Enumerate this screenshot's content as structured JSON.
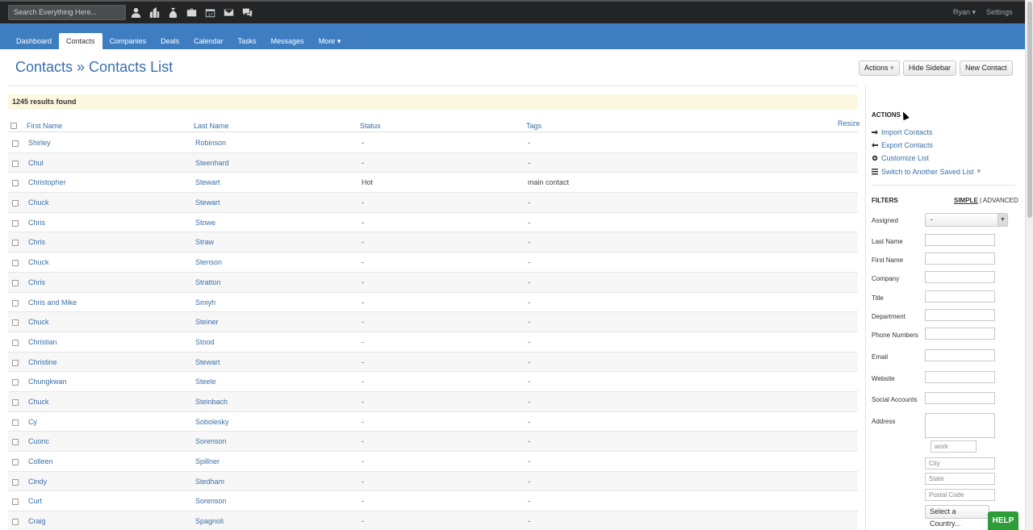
{
  "topbar": {
    "search_placeholder": "Search Everything Here...",
    "icons": [
      "person-icon",
      "building-icon",
      "money-bag-icon",
      "briefcase-icon",
      "calendar-icon",
      "envelope-icon",
      "chat-icon"
    ],
    "calendar_day": "17",
    "user_label": "Ryan",
    "settings_label": "Settings"
  },
  "nav": {
    "tabs": [
      "Dashboard",
      "Contacts",
      "Companies",
      "Deals",
      "Calendar",
      "Tasks",
      "Messages",
      "More"
    ],
    "active_tab": "Contacts"
  },
  "header": {
    "title": "Contacts » Contacts List",
    "actions_label": "Actions",
    "hide_sidebar_label": "Hide Sidebar",
    "new_contact_label": "New Contact"
  },
  "results": {
    "text": "1245 results found"
  },
  "table": {
    "columns": [
      "First Name",
      "Last Name",
      "Status",
      "Tags"
    ],
    "resize_label": "Resize",
    "rows": [
      [
        "Shirley",
        "Robinson",
        "-",
        "-"
      ],
      [
        "Chul",
        "Steenhard",
        "-",
        "-"
      ],
      [
        "Christopher",
        "Stewart",
        "Hot",
        "main contact"
      ],
      [
        "Chuck",
        "Stewart",
        "-",
        "-"
      ],
      [
        "Chris",
        "Stowe",
        "-",
        "-"
      ],
      [
        "Chris",
        "Straw",
        "-",
        "-"
      ],
      [
        "Chuck",
        "Stenson",
        "-",
        "-"
      ],
      [
        "Chris",
        "Stratton",
        "-",
        "-"
      ],
      [
        "Chris and Mike",
        "Smiyh",
        "-",
        "-"
      ],
      [
        "Chuck",
        "Steiner",
        "-",
        "-"
      ],
      [
        "Christian",
        "Stood",
        "-",
        "-"
      ],
      [
        "Christine",
        "Stewart",
        "-",
        "-"
      ],
      [
        "Chungkwan",
        "Steele",
        "-",
        "-"
      ],
      [
        "Chuck",
        "Steinbach",
        "-",
        "-"
      ],
      [
        "Cy",
        "Sobolesky",
        "-",
        "-"
      ],
      [
        "Cuonc",
        "Sorenson",
        "-",
        "-"
      ],
      [
        "Colleen",
        "Spillner",
        "-",
        "-"
      ],
      [
        "Cindy",
        "Stedham",
        "-",
        "-"
      ],
      [
        "Curt",
        "Sorenson",
        "-",
        "-"
      ],
      [
        "Craig",
        "Spagnoli",
        "-",
        "-"
      ]
    ]
  },
  "sidebar": {
    "actions_title": "ACTIONS",
    "links": [
      "Import Contacts",
      "Export Contacts",
      "Customize List",
      "Switch to Another Saved List"
    ],
    "filters_title": "FILTERS",
    "simple_label": "SIMPLE",
    "advanced_label": "ADVANCED",
    "assigned_label": "Assigned",
    "assigned_value": "-",
    "fields": [
      "Last Name",
      "First Name",
      "Company",
      "Title",
      "Department",
      "Phone Numbers",
      "Email",
      "Website",
      "Social Accounts",
      "Address"
    ],
    "address_type_placeholder": "work",
    "city_placeholder": "City",
    "state_placeholder": "State",
    "postal_placeholder": "Postal Code",
    "country_value": "Select a Country..."
  },
  "help_label": "HELP"
}
